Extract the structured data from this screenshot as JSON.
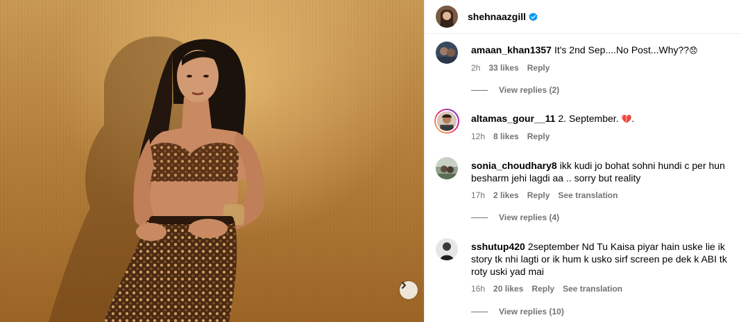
{
  "post_author": {
    "username": "shehnaazgill",
    "verified": true
  },
  "photo": {
    "next_icon": "chevron-right-icon"
  },
  "comments": [
    {
      "username": "amaan_khan1357",
      "text": "It's 2nd Sep....No Post...Why??",
      "emoji": "😞",
      "time": "2h",
      "likes": "33 likes",
      "reply": "Reply",
      "view_replies": "View replies (2)"
    },
    {
      "username": "altamas_gour__11",
      "text": "2. September.",
      "emoji": "💔",
      "suffix": ".",
      "time": "12h",
      "likes": "8 likes",
      "reply": "Reply"
    },
    {
      "username": "sonia_choudhary8",
      "text": "ikk kudi jo bohat sohni hundi c per hun besharm jehi lagdi aa .. sorry but reality",
      "time": "17h",
      "likes": "2 likes",
      "reply": "Reply",
      "see_translation": "See translation",
      "view_replies": "View replies (4)"
    },
    {
      "username": "sshutup420",
      "text": "2september Nd Tu Kaisa piyar hain uske lie ik story tk nhi lagti or ik hum k usko sirf screen pe dek k ABI tk roty uski yad mai",
      "time": "16h",
      "likes": "20 likes",
      "reply": "Reply",
      "see_translation": "See translation",
      "view_replies": "View replies (10)"
    }
  ],
  "colors": {
    "secondary_text": "#737373",
    "verified_blue": "#0095f6",
    "divider": "#efefef"
  }
}
